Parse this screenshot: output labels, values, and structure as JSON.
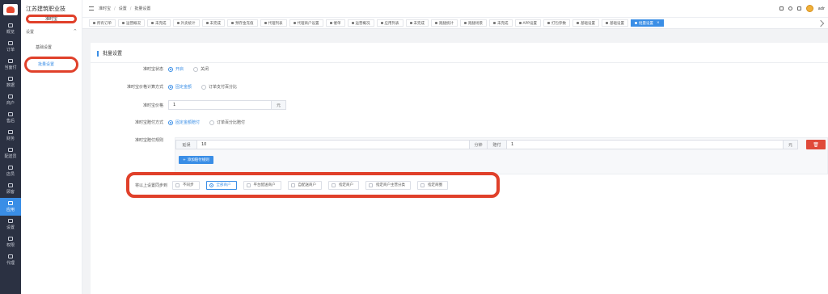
{
  "rail": {
    "items": [
      {
        "label": "概览",
        "icon": "grid-icon"
      },
      {
        "label": "订单",
        "icon": "order-icon"
      },
      {
        "label": "当面付",
        "icon": "pay-icon"
      },
      {
        "label": "数据",
        "icon": "data-icon"
      },
      {
        "label": "商户",
        "icon": "store-icon"
      },
      {
        "label": "售后",
        "icon": "headset-icon"
      },
      {
        "label": "财务",
        "icon": "finance-icon"
      },
      {
        "label": "配送员",
        "icon": "courier-icon"
      },
      {
        "label": "店员",
        "icon": "clerk-icon"
      },
      {
        "label": "顾客",
        "icon": "customer-icon"
      },
      {
        "label": "应用",
        "icon": "apps-icon"
      },
      {
        "label": "设置",
        "icon": "settings-icon"
      },
      {
        "label": "权限",
        "icon": "lock-icon"
      },
      {
        "label": "代理",
        "icon": "agent-icon"
      }
    ],
    "active_index": 10
  },
  "submenu": {
    "company": "江苏建筑职业技",
    "title": "准时宝",
    "group": "设置",
    "group_arrow": "^",
    "items": [
      "基础设置",
      "批量设置"
    ],
    "active_index": 1
  },
  "topbar": {
    "breadcrumb": [
      "准时宝",
      "设置",
      "批量设置"
    ],
    "username": "adr"
  },
  "tabs": [
    "所有订单",
    "运营概况",
    "未完成",
    "外卖统计",
    "未完成",
    "预存金充值",
    "代理列表",
    "代理商户设置",
    "催单",
    "运营概况",
    "应用列表",
    "未完成",
    "跑腿统计",
    "跑腿场景",
    "未完成",
    "APP设置",
    "打包参数",
    "基础设置",
    "基础设置",
    "批量设置"
  ],
  "active_tab_index": 19,
  "form": {
    "card_title": "批量设置",
    "status": {
      "label": "准时宝状态",
      "options": [
        "开启",
        "关闭"
      ],
      "selected": 0
    },
    "price_mode": {
      "label": "准时宝价格计算方式",
      "options": [
        "固定金额",
        "订单支付百分比"
      ],
      "selected": 0
    },
    "price": {
      "label": "准时宝价格",
      "value": "1",
      "unit": "元"
    },
    "comp_mode": {
      "label": "准时宝赔付方式",
      "options": [
        "固定金额赔付",
        "订单百分比赔付"
      ],
      "selected": 0
    },
    "rules": {
      "label": "准时宝赔付规则",
      "delay_prefix": "延误",
      "delay_value": "10",
      "delay_unit": "分钟",
      "comp_prefix": "赔付",
      "comp_value": "1",
      "comp_unit": "元",
      "delete_icon": "trash-icon",
      "add_label": "添加赔付规则"
    },
    "sync": {
      "label": "将以上设置同步到",
      "options": [
        "不同步",
        "全部商户",
        "平台配送商户",
        "自配送商户",
        "指定商户",
        "指定商户主营分类",
        "指定商圈"
      ],
      "selected": 1
    }
  },
  "colors": {
    "accent": "#3a8ee6",
    "highlight": "#e0402a",
    "rail": "#2b3142",
    "danger": "#e04a3a"
  }
}
